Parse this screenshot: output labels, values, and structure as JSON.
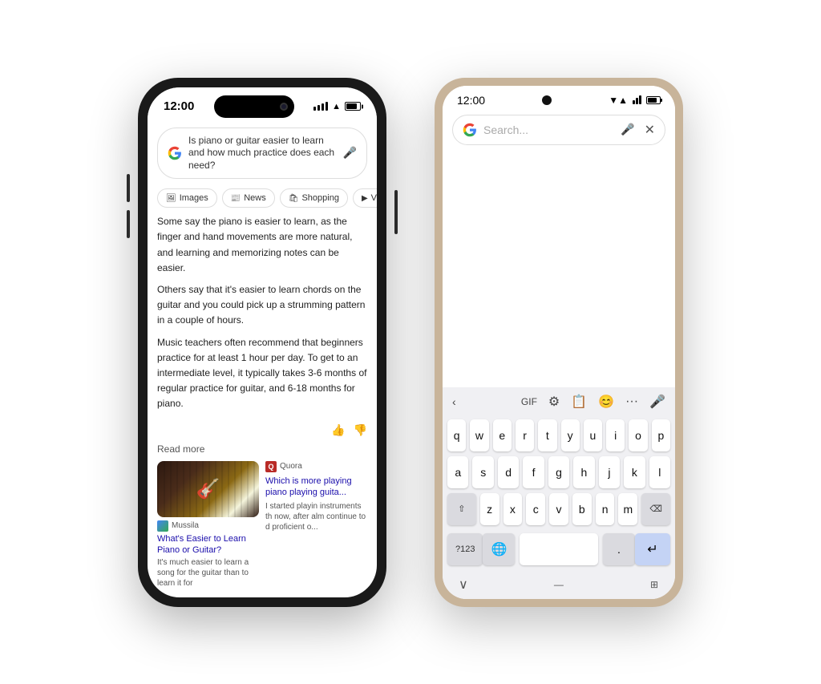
{
  "iphone": {
    "time": "12:00",
    "search_query": "Is piano or guitar easier to learn and how much practice does each need?",
    "filters": [
      {
        "icon": "🖼",
        "label": "Images"
      },
      {
        "icon": "📰",
        "label": "News"
      },
      {
        "icon": "🛍",
        "label": "Shopping"
      },
      {
        "icon": "▶",
        "label": "Vide..."
      }
    ],
    "ai_paragraphs": [
      "Some say the piano is easier to learn, as the finger and hand movements are more natural, and learning and memorizing notes can be easier.",
      "Others say that it's easier to learn chords on the guitar and you could pick up a strumming pattern in a couple of hours.",
      "Music teachers often recommend that beginners practice for at least 1 hour per day. To get to an intermediate level, it typically takes 3-6 months of regular practice for guitar, and 6-18 months for piano."
    ],
    "read_more": "Read more",
    "card1": {
      "source": "Mussila",
      "title": "What's Easier to Learn Piano or Guitar?",
      "desc": "It's much easier to learn a song for the guitar than to learn it for"
    },
    "card2": {
      "source": "Quora",
      "title": "Which is more playing piano playing guita...",
      "desc": "I started playin instruments th now, after alm continue to d proficient o..."
    }
  },
  "android": {
    "time": "12:00",
    "search_placeholder": "Search...",
    "keyboard": {
      "toolbar": [
        "GIF",
        "⚙",
        "📋",
        "😊",
        "···",
        "🎤"
      ],
      "row1": [
        "q",
        "w",
        "e",
        "r",
        "t",
        "y",
        "u",
        "i",
        "o",
        "p"
      ],
      "row2": [
        "a",
        "s",
        "d",
        "f",
        "g",
        "h",
        "j",
        "k",
        "l"
      ],
      "row3": [
        "z",
        "x",
        "c",
        "v",
        "b",
        "n",
        "m"
      ],
      "special_left": "⇧",
      "special_right": "⌫",
      "bottom": [
        "?123",
        "🌐",
        "space",
        ".",
        "↵"
      ]
    }
  }
}
